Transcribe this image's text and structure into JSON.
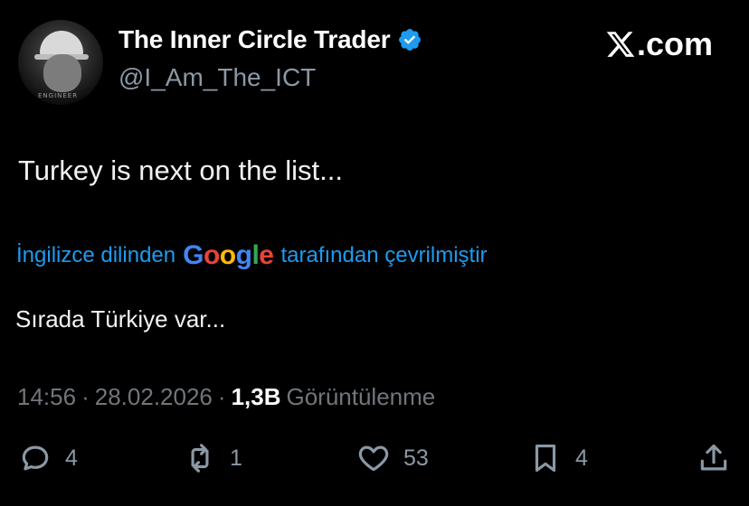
{
  "author": {
    "display_name": "The Inner Circle Trader",
    "handle": "@I_Am_The_ICT",
    "avatar_text": "ENGINEER"
  },
  "brand": {
    "text": ".com",
    "logo": "x-logo-icon"
  },
  "tweet": {
    "text": "Turkey is next on the list..."
  },
  "translation": {
    "prefix": "İngilizce dilinden",
    "provider": "Google",
    "suffix": "tarafından çevrilmiştir",
    "text": "Sırada Türkiye var..."
  },
  "meta": {
    "time": "14:56",
    "sep1": "·",
    "date": "28.02.2026",
    "sep2": "·",
    "views_count": "1,3B",
    "views_label": "Görüntülenme"
  },
  "actions": {
    "replies": "4",
    "reposts": "1",
    "likes": "53",
    "bookmarks": "4"
  },
  "colors": {
    "background": "#000000",
    "link": "#1d9bf0",
    "muted": "#71767b",
    "verified": "#1d9bf0"
  }
}
